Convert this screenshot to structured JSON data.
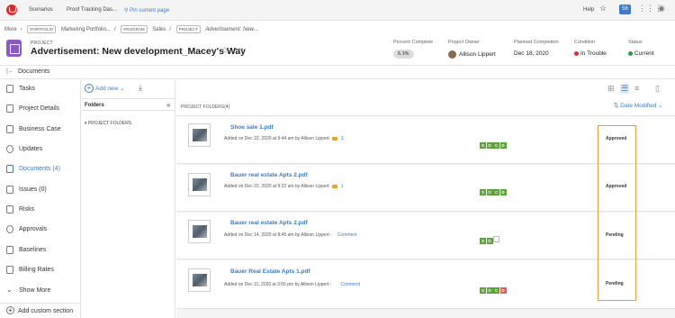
{
  "topbar": {
    "tabs": [
      "Scenarios",
      "Proof Tracking Das..."
    ],
    "pin_label": "Pin current page",
    "help": "Help",
    "notif_count": "56"
  },
  "breadcrumb": {
    "more": "More",
    "items": [
      {
        "tag": "PORTFOLIO",
        "text": "Marketing Portfolio..."
      },
      {
        "tag": "PROGRAM",
        "text": "Sales"
      },
      {
        "tag": "PROJECT",
        "text": "Advertisement: New..."
      }
    ]
  },
  "project": {
    "label": "PROJECT",
    "title": "Advertisement: New development_Macey's Way"
  },
  "meta": {
    "percent_label": "Percent Complete",
    "percent_value": "6.1%",
    "owner_label": "Project Owner",
    "owner_value": "Allison Lippert",
    "planned_label": "Planned Completion",
    "planned_value": "Dec 18, 2020",
    "condition_label": "Condition",
    "condition_value": "In Trouble",
    "status_label": "Status",
    "status_value": "Current"
  },
  "colors": {
    "accent": "#3b7cc9",
    "condition": "#e02c2c",
    "status": "#2e9e3e",
    "highlight": "#f39c34",
    "socd": "#5aa43a"
  },
  "docs_header": "Documents",
  "sidebar": {
    "items": [
      {
        "label": "Tasks",
        "icon": "tasks-icon"
      },
      {
        "label": "Project Details",
        "icon": "details-icon"
      },
      {
        "label": "Business Case",
        "icon": "business-case-icon"
      },
      {
        "label": "Updates",
        "icon": "updates-icon"
      },
      {
        "label": "Documents (4)",
        "icon": "documents-icon"
      },
      {
        "label": "Issues (0)",
        "icon": "issues-icon"
      },
      {
        "label": "Risks",
        "icon": "risks-icon"
      },
      {
        "label": "Approvals",
        "icon": "approvals-icon"
      },
      {
        "label": "Baselines",
        "icon": "baselines-icon"
      },
      {
        "label": "Billing Rates",
        "icon": "billing-icon"
      },
      {
        "label": "Show More",
        "icon": "chevron-down-icon"
      }
    ],
    "add_section": "Add custom section"
  },
  "toolbar": {
    "add_new": "Add new"
  },
  "folders": {
    "title": "Folders",
    "tree_root": "PROJECT FOLDERS"
  },
  "main": {
    "folder_title": "PROJECT FOLDERS(4)",
    "sort_label": "Date Modified"
  },
  "documents": [
    {
      "name": "Shoe sale 1.pdf",
      "meta": "Added on Dec 22, 2020 at 9:44 am by Allison Lippert",
      "extra": "3",
      "status": "Approved",
      "socd": [
        "S",
        "O",
        "C",
        "D"
      ]
    },
    {
      "name": "Bauer real estate Apts 2.pdf",
      "meta": "Added on Dec 22, 2020 at 9:22 am by Allison Lippert",
      "extra": "1",
      "status": "Approved",
      "socd": [
        "S",
        "O",
        "C",
        "D"
      ]
    },
    {
      "name": "Bauer real estate Apts 2.pdf",
      "meta": "Added on Dec 14, 2020 at 8:45 am by Allison Lippert -",
      "extra": "Comment",
      "status": "Pending",
      "socd": [
        "S",
        "O"
      ]
    },
    {
      "name": "Bauer Real Estate Apts 1.pdf",
      "meta": "Added on Dec 11, 2020 at 3:55 pm by Allison Lippert -",
      "extra": "Comment",
      "status": "Pending",
      "socd": [
        "S",
        "O",
        "C",
        "D"
      ]
    }
  ]
}
